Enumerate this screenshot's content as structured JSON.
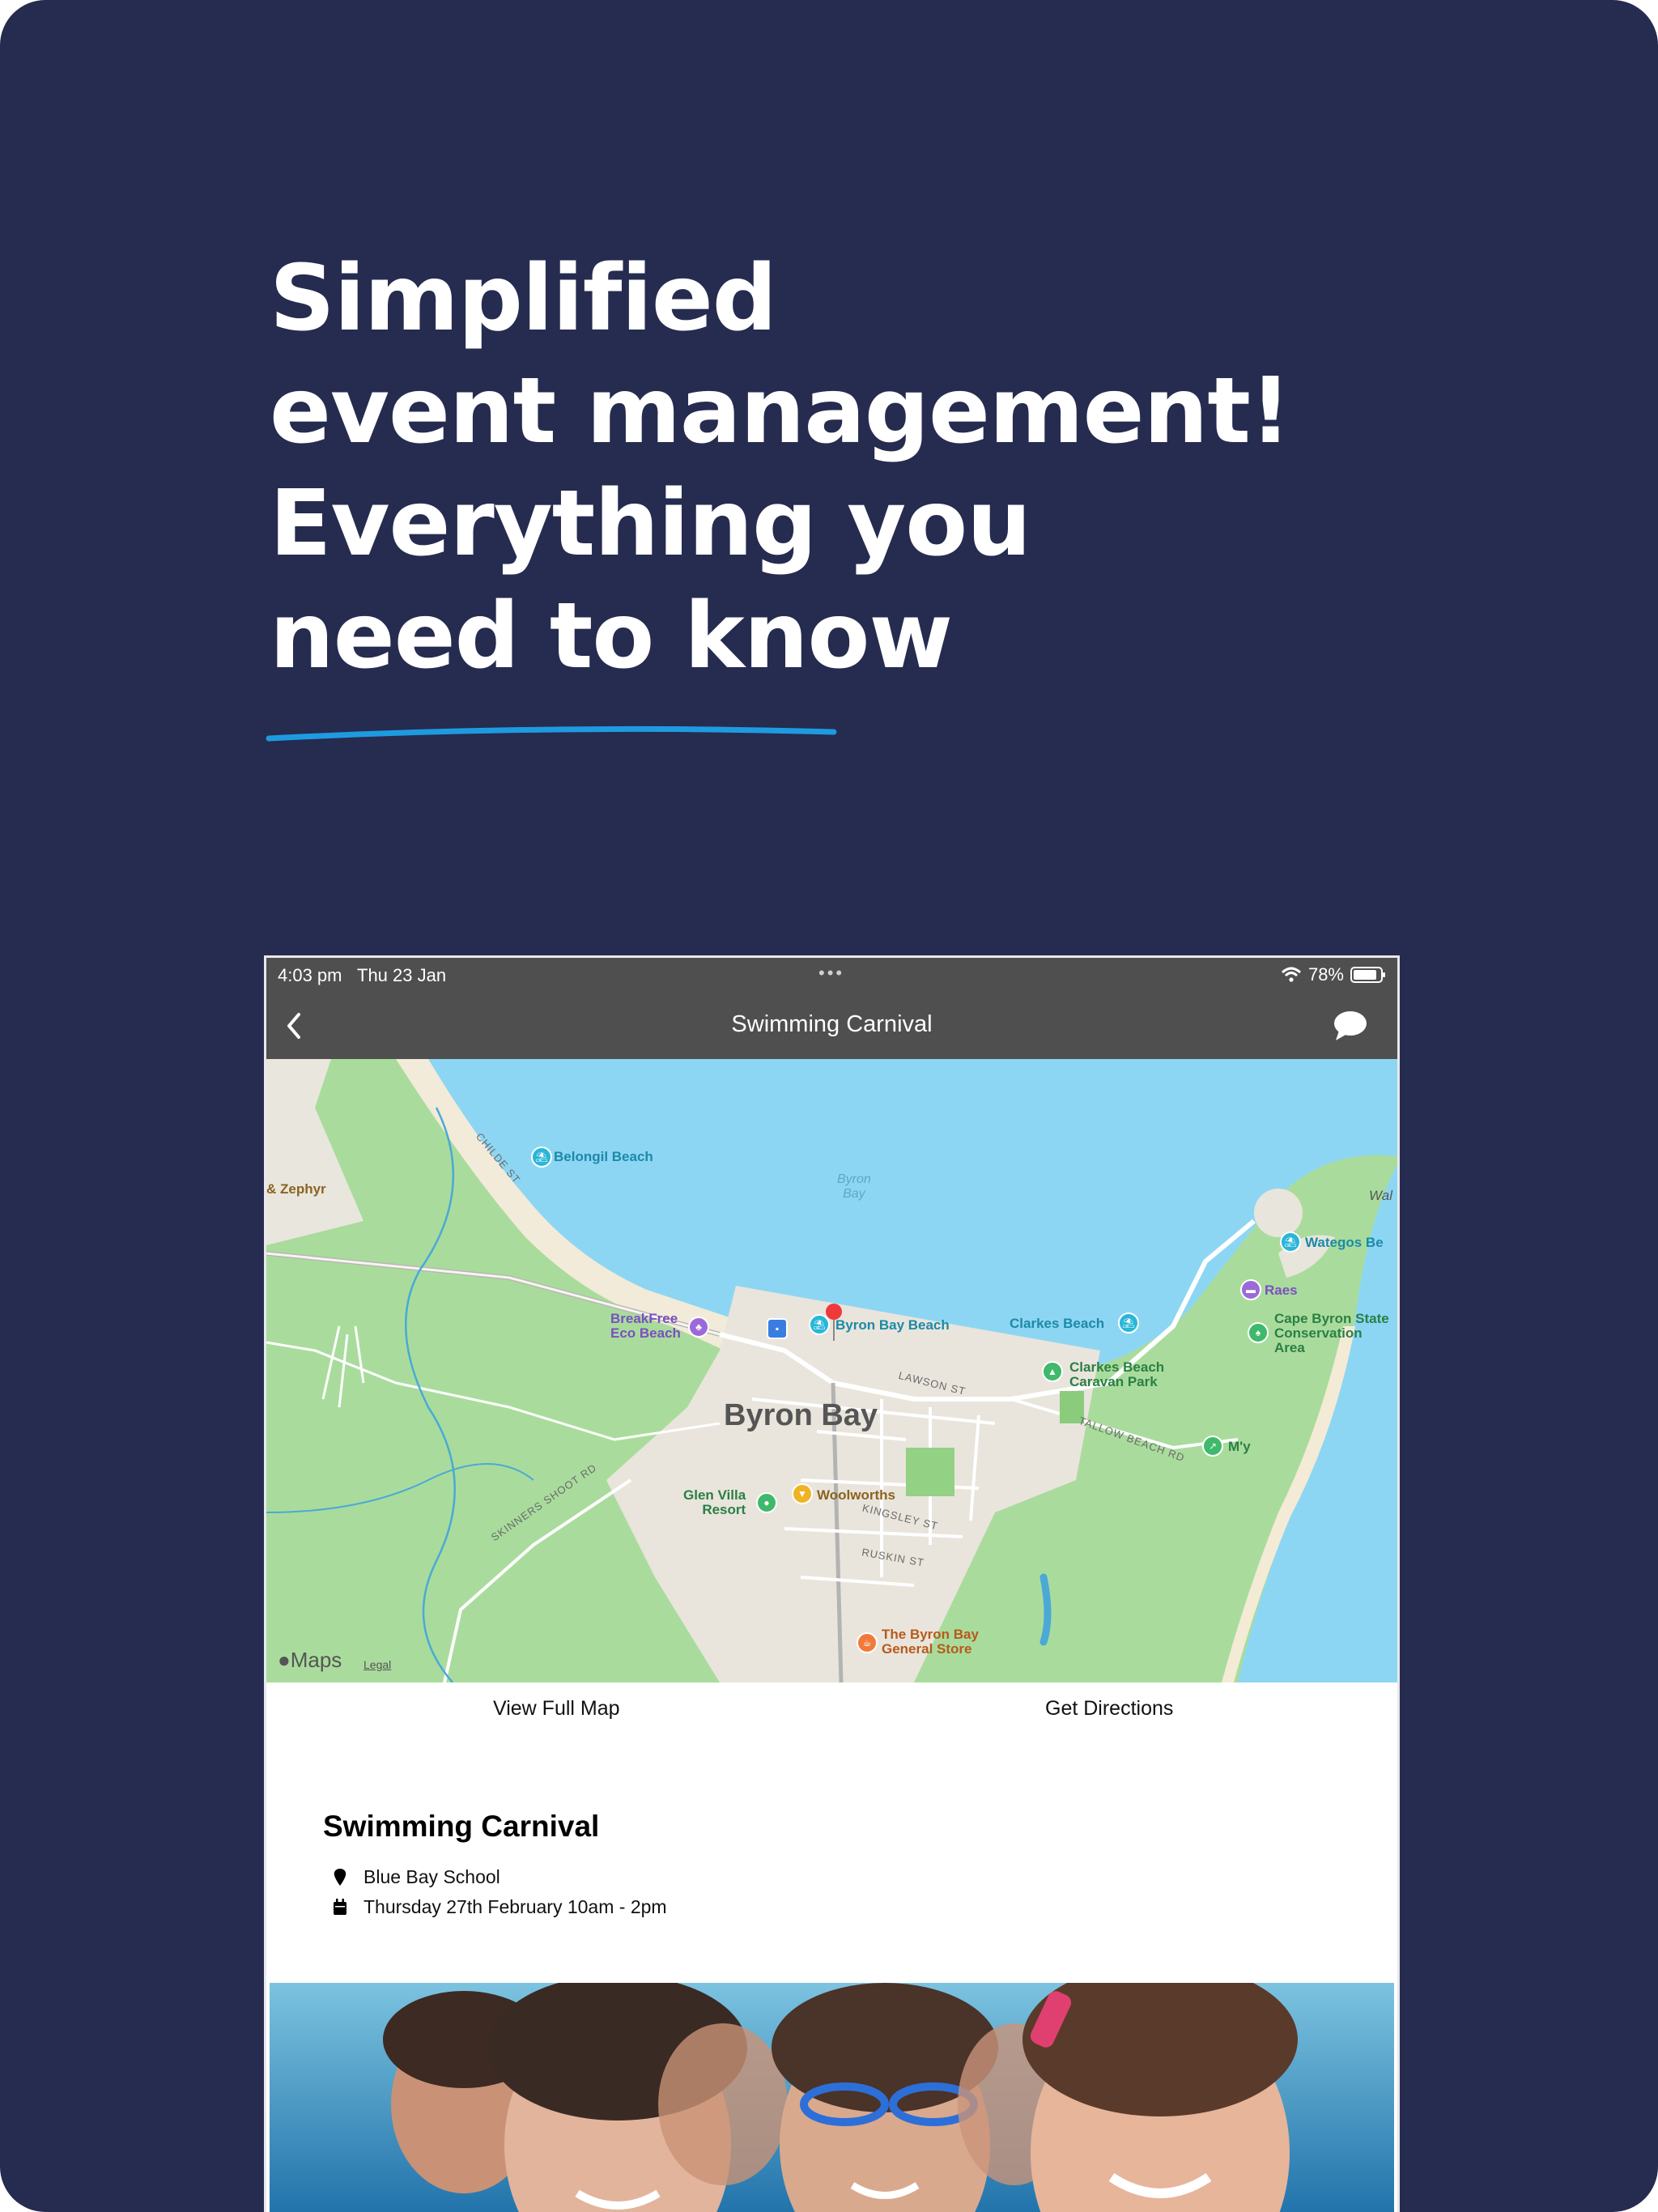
{
  "headline": {
    "lines": [
      "Simplified",
      "event management!",
      "Everything you",
      "need to know"
    ]
  },
  "colors": {
    "background": "#262b50",
    "accent": "#1e9be0",
    "toolbar": "#4f4f4f"
  },
  "status_bar": {
    "time": "4:03 pm",
    "date": "Thu 23 Jan",
    "battery": "78%"
  },
  "nav": {
    "title": "Swimming Carnival",
    "back_icon": "chevron-left-icon",
    "chat_icon": "chat-bubble-icon"
  },
  "map": {
    "bay_label": "Byron\nBay",
    "town_label": "Byron Bay",
    "places": {
      "belongil": "Belongil Beach",
      "zephyr": "& Zephyr",
      "breakfree": "BreakFree\nEco Beach",
      "byron_beach": "Byron Bay Beach",
      "clarkes": "Clarkes Beach",
      "clarkes_park": "Clarkes Beach\nCaravan Park",
      "wategos": "Wategos Be",
      "wal": "Wal",
      "raes": "Raes",
      "cape": "Cape Byron State\nConservation\nArea",
      "glen": "Glen Villa\nResort",
      "woolworths": "Woolworths",
      "store": "The Byron Bay\nGeneral Store",
      "my": "M'y"
    },
    "streets": {
      "childe": "CHILDE ST",
      "lawson": "LAWSON ST",
      "tallow": "TALLOW BEACH RD",
      "skinners": "SKINNERS SHOOT RD",
      "kingsley": "KINGSLEY ST",
      "ruskin": "RUSKIN ST"
    },
    "attribution": "Maps",
    "legal": "Legal"
  },
  "actions": {
    "view_map": "View Full Map",
    "directions": "Get Directions"
  },
  "event": {
    "title": "Swimming Carnival",
    "location": "Blue Bay School",
    "datetime": "Thursday 27th February 10am - 2pm"
  }
}
